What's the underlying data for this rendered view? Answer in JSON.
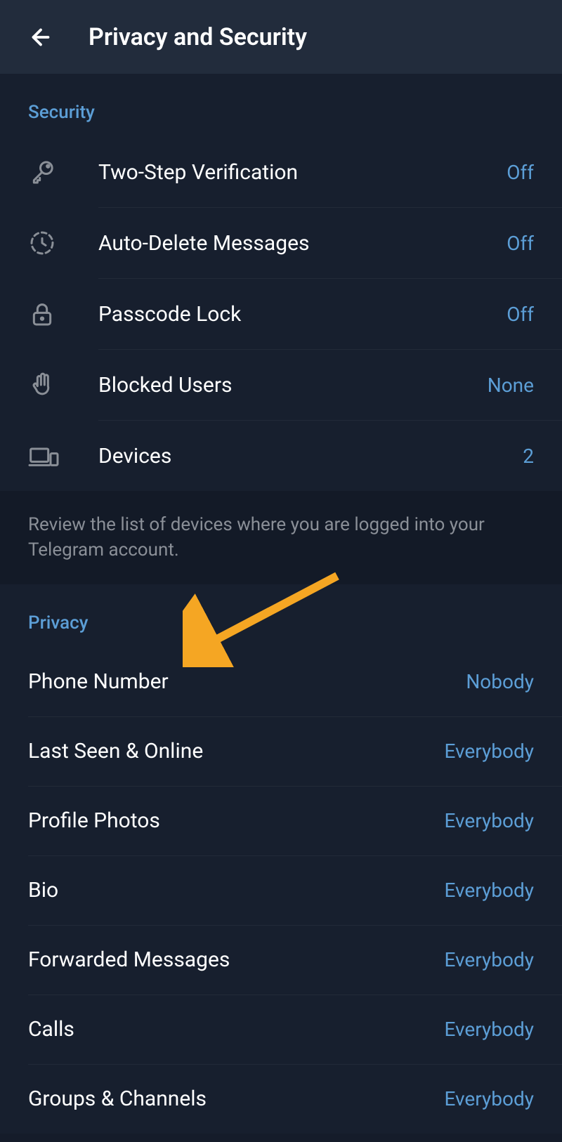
{
  "header": {
    "title": "Privacy and Security"
  },
  "sections": {
    "security": {
      "title": "Security",
      "items": [
        {
          "label": "Two-Step Verification",
          "value": "Off"
        },
        {
          "label": "Auto-Delete Messages",
          "value": "Off"
        },
        {
          "label": "Passcode Lock",
          "value": "Off"
        },
        {
          "label": "Blocked Users",
          "value": "None"
        },
        {
          "label": "Devices",
          "value": "2"
        }
      ],
      "info": "Review the list of devices where you are logged into your Telegram account."
    },
    "privacy": {
      "title": "Privacy",
      "items": [
        {
          "label": "Phone Number",
          "value": "Nobody"
        },
        {
          "label": "Last Seen & Online",
          "value": "Everybody"
        },
        {
          "label": "Profile Photos",
          "value": "Everybody"
        },
        {
          "label": "Bio",
          "value": "Everybody"
        },
        {
          "label": "Forwarded Messages",
          "value": "Everybody"
        },
        {
          "label": "Calls",
          "value": "Everybody"
        },
        {
          "label": "Groups & Channels",
          "value": "Everybody"
        }
      ]
    }
  }
}
